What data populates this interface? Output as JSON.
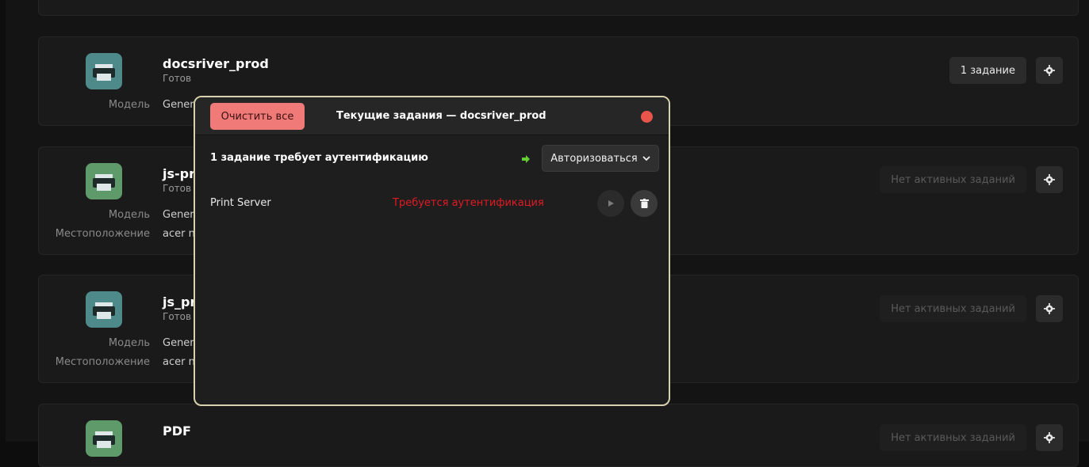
{
  "printers": [
    {
      "name": "docsriver_prod",
      "status": "Готов",
      "model_label": "Модель",
      "model_value": "Gener",
      "jobs_label": "1 задание",
      "icon_color": "#4f8a8b"
    },
    {
      "name": "js-pri",
      "status": "Готов",
      "model_label": "Модель",
      "model_value": "Gener",
      "location_label": "Местоположение",
      "location_value": "acer n",
      "jobs_label": "Нет активных заданий",
      "icon_color": "#5e9a6a"
    },
    {
      "name": "js_pr",
      "status": "Готов",
      "model_label": "Модель",
      "model_value": "Gener",
      "location_label": "Местоположение",
      "location_value": "acer n",
      "jobs_label": "Нет активных заданий",
      "icon_color": "#4f8a8b"
    },
    {
      "name": "PDF",
      "status": "",
      "jobs_label": "Нет активных заданий",
      "icon_color": "#5e9a6a"
    }
  ],
  "dialog": {
    "clear_all_label": "Очистить все",
    "title": "Текущие задания — docsriver_prod",
    "auth_message": "1 задание требует аутентификацию",
    "authorize_label": "Авторизоваться",
    "jobs": [
      {
        "name": "Print Server",
        "status": "Требуется аутентификация"
      }
    ]
  },
  "icons": {
    "printer": "printer-icon",
    "gear": "gear-icon",
    "close": "close-icon",
    "arrow": "arrow-right-icon",
    "chevron": "chevron-down-icon",
    "play": "play-icon",
    "trash": "trash-icon"
  },
  "colors": {
    "accent_clear": "#f07a78",
    "error_text": "#e01b24",
    "close_dot": "#e9544b",
    "dialog_border": "#d9d0ae",
    "arrow_green": "#66cc33"
  }
}
